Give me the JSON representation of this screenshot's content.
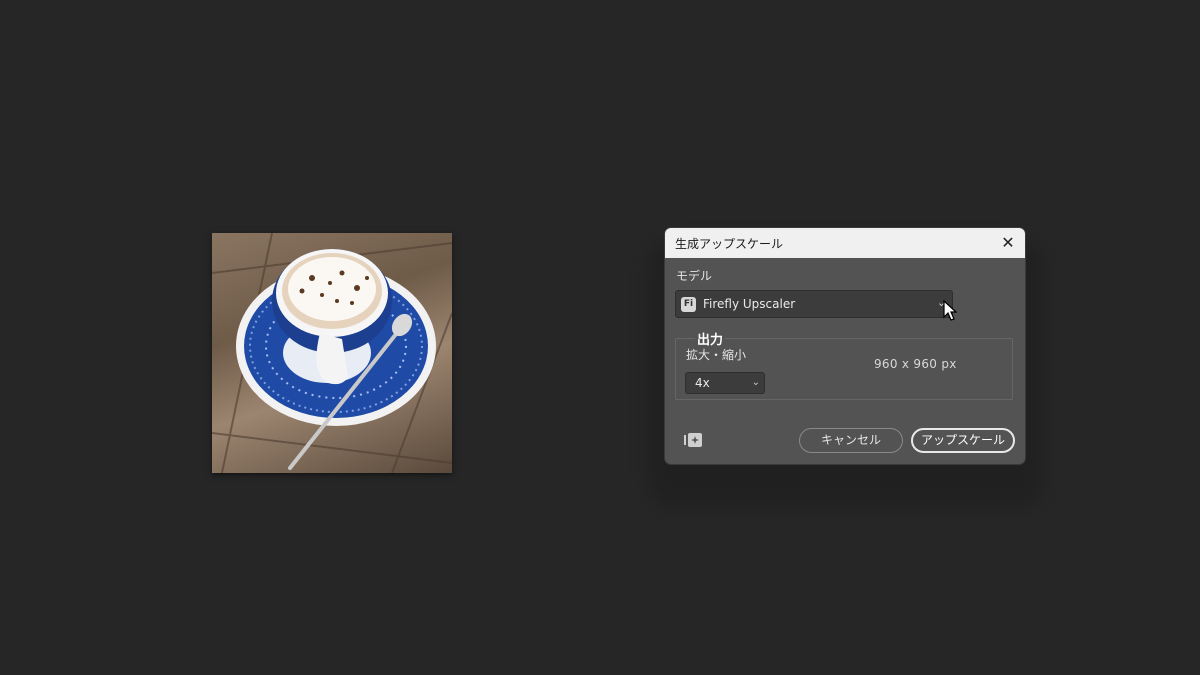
{
  "dialog": {
    "title": "生成アップスケール",
    "model_label": "モデル",
    "model_value": "Firefly Upscaler",
    "model_icon_text": "Fi",
    "output_title": "出力",
    "scale_label": "拡大・縮小",
    "scale_value": "4x",
    "output_size": "960 x 960 px",
    "cancel_label": "キャンセル",
    "upscale_label": "アップスケール"
  },
  "icons": {
    "close": "close-icon",
    "dropdown": "chevron-down-icon",
    "corner": "image-sparkle-icon",
    "cursor": "mouse-pointer-icon"
  }
}
